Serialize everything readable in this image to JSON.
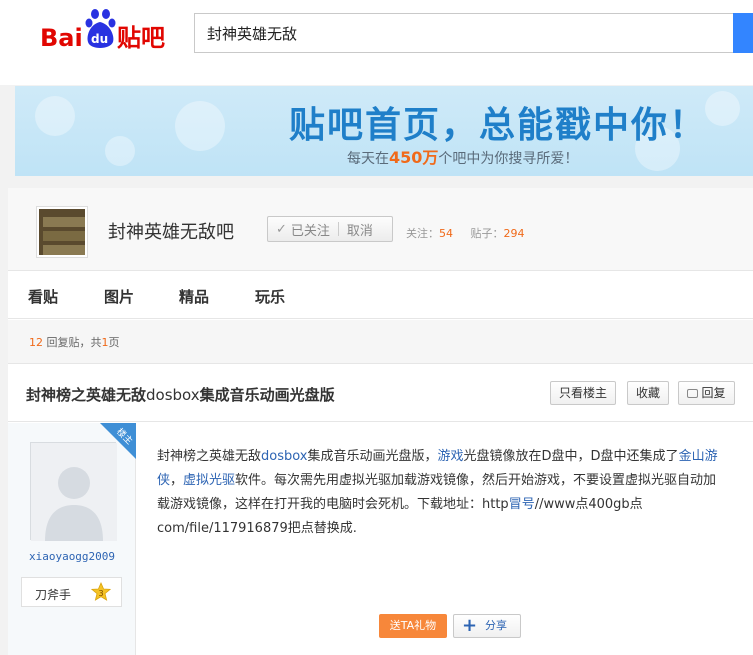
{
  "header": {
    "logo_text_bai": "Bai",
    "logo_text_du": "du",
    "logo_text_tieba": "贴吧",
    "search_value": "封神英雄无敌"
  },
  "banner": {
    "title": "贴吧首页，总能戳中你！",
    "sub_before": "每天在",
    "sub_highlight": "450万",
    "sub_after": "个吧中为你搜寻所爱！"
  },
  "forum": {
    "name": "封神英雄无敌吧",
    "follow_label": "已关注",
    "unfollow_label": "取消",
    "followers_label": "关注：",
    "followers_count": "54",
    "posts_label": "贴子：",
    "posts_count": "294"
  },
  "tabs": [
    {
      "label": "看贴"
    },
    {
      "label": "图片"
    },
    {
      "label": "精品"
    },
    {
      "label": "玩乐"
    }
  ],
  "replybar": {
    "count": "12",
    "text_mid": "回复贴，共",
    "pages": "1",
    "text_end": "页"
  },
  "thread": {
    "title_a": "封神榜之英雄无敌",
    "title_b": "dosbox",
    "title_c": "集成音乐动画光盘版",
    "btn_louzhu": "只看楼主",
    "btn_collect": "收藏",
    "btn_reply": "回复"
  },
  "post": {
    "badge": "楼主",
    "author": "xiaoyaogg2009",
    "rank_label": "刀斧手",
    "rank_level": "3",
    "p1": "封神榜之英雄无敌",
    "p1_link": "dosbox",
    "p2": "集成音乐动画光盘版，",
    "p2_link": "游戏",
    "p3": "光盘镜像放在D盘中，D盘中还集成了",
    "p3_link": "金山游侠",
    "p4": "，",
    "p4_link": "虚拟光驱",
    "p5": "软件。每次需先用虚拟光驱加载游戏镜像，然后开始游戏，不要设置虚拟光驱自动加载游戏镜像，这样在打开我的电脑时会死机。下载地址：http",
    "p5_link": "冒号",
    "p6": "//www点400gb点com/file/117916879把点替换成.",
    "gift_label": "送TA礼物",
    "share_label": "分享"
  }
}
